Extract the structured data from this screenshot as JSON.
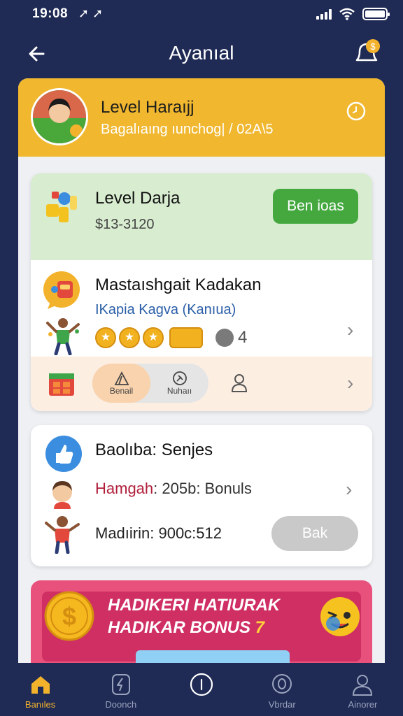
{
  "status_bar": {
    "time": "19:08",
    "location_glyph": "➚ ➚"
  },
  "header": {
    "title": "Ayanıal"
  },
  "profile": {
    "name": "Level Haraıjj",
    "subtitle": "Bagalıaıng ıunchog| / 02A\\5"
  },
  "level_card": {
    "title": "Level Darja",
    "value": "$13-3120",
    "button_label": "Ben ioas"
  },
  "quest_card": {
    "title": "Mastaıshgait Kadakan",
    "subtitle": "IKapia Kagva (Kanıua)",
    "count": "4",
    "segments": [
      "Benail",
      "Nuhaıı"
    ]
  },
  "bonus_card": {
    "title": "Baolıba: Senjes",
    "row1_highlight": "Hamgah",
    "row1_rest": ": 205b: Bonuls",
    "row2": "Madıirin: 900c:512",
    "button_label": "Bak"
  },
  "promo": {
    "line1": "HADIKERI HATIURAK",
    "line2": "HADIKAR BONUS",
    "line2_accent": "7"
  },
  "tabs": [
    {
      "label": "Banıles",
      "icon": "home-icon",
      "active": true
    },
    {
      "label": "Doonch",
      "icon": "bolt-icon",
      "active": false
    },
    {
      "label": "",
      "icon": "circle-icon",
      "active": false
    },
    {
      "label": "Vbrdar",
      "icon": "badge-icon",
      "active": false
    },
    {
      "label": "Ainorer",
      "icon": "user-icon",
      "active": false
    }
  ],
  "colors": {
    "background": "#1f2b55",
    "profile_header": "#f0b72f",
    "primary_button": "#44a83f",
    "disabled_button": "#c9c9c9",
    "promo": "#e9517d",
    "active_tab": "#f3b22c"
  }
}
